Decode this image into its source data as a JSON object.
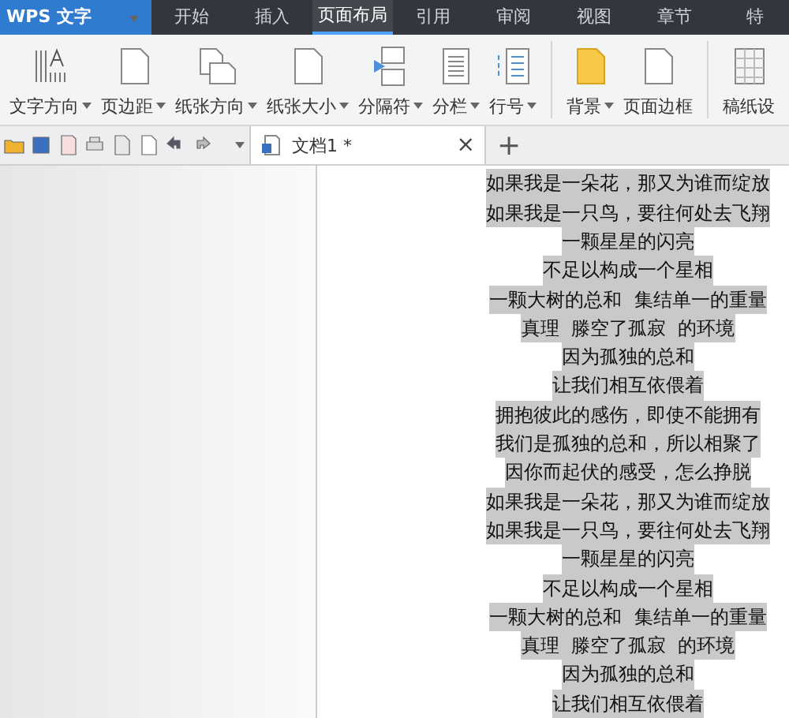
{
  "app_button": {
    "label": "WPS 文字"
  },
  "menu_tabs": [
    {
      "label": "开始",
      "selected": false
    },
    {
      "label": "插入",
      "selected": false
    },
    {
      "label": "页面布局",
      "selected": true
    },
    {
      "label": "引用",
      "selected": false
    },
    {
      "label": "审阅",
      "selected": false
    },
    {
      "label": "视图",
      "selected": false
    },
    {
      "label": "章节",
      "selected": false
    },
    {
      "label": "特",
      "selected": false
    }
  ],
  "ribbon": [
    {
      "label": "文字方向",
      "dropdown": true
    },
    {
      "label": "页边距",
      "dropdown": true
    },
    {
      "label": "纸张方向",
      "dropdown": true
    },
    {
      "label": "纸张大小",
      "dropdown": true
    },
    {
      "label": "分隔符",
      "dropdown": true
    },
    {
      "label": "分栏",
      "dropdown": true
    },
    {
      "label": "行号",
      "dropdown": true
    },
    {
      "label": "背景",
      "dropdown": true
    },
    {
      "label": "页面边框",
      "dropdown": false
    },
    {
      "label": "稿纸设",
      "dropdown": false
    }
  ],
  "document_tab": {
    "title": "文档1 *",
    "close": "×"
  },
  "new_tab": "+",
  "lines": [
    "如果我是一朵花，那又为谁而绽放",
    "如果我是一只鸟，要往何处去飞翔",
    "一颗星星的闪亮",
    "不足以构成一个星相",
    "一颗大树的总和  集结单一的重量",
    "真理  滕空了孤寂  的环境",
    "因为孤独的总和",
    "让我们相互依偎着",
    "拥抱彼此的感伤，即使不能拥有",
    "我们是孤独的总和，所以相聚了",
    "因你而起伏的感受，怎么挣脱",
    "如果我是一朵花，那又为谁而绽放",
    "如果我是一只鸟，要往何处去飞翔",
    "一颗星星的闪亮",
    "不足以构成一个星相",
    "一颗大树的总和  集结单一的重量",
    "真理  滕空了孤寂  的环境",
    "因为孤独的总和",
    "让我们相互依偎着"
  ]
}
